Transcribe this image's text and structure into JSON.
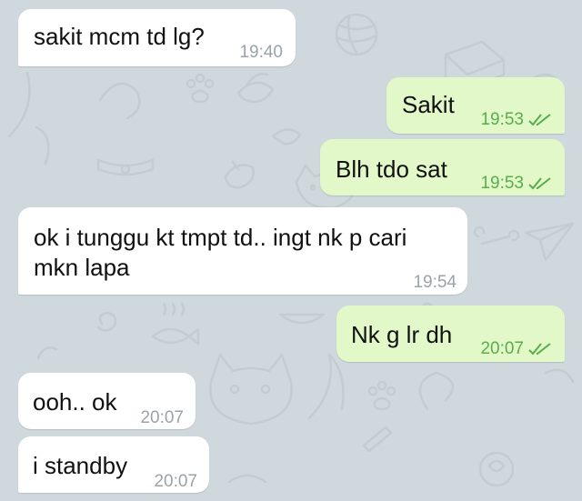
{
  "colors": {
    "background": "#cfd8dc",
    "incoming_bubble": "#ffffff",
    "outgoing_bubble": "#e2f8c8",
    "outgoing_time": "#58ad4c",
    "incoming_time": "#9aa3a8",
    "doodle": "#c3cdd1"
  },
  "messages": [
    {
      "direction": "incoming",
      "text": "sakit mcm td lg?",
      "time": "19:40"
    },
    {
      "direction": "outgoing",
      "text": "Sakit",
      "time": "19:53",
      "status": "read-double-check-icon"
    },
    {
      "direction": "outgoing",
      "text": "Blh tdo sat",
      "time": "19:53",
      "status": "read-double-check-icon"
    },
    {
      "direction": "incoming",
      "text": "ok i tunggu kt tmpt td.. ingt nk p cari\nmkn lapa",
      "time": "19:54"
    },
    {
      "direction": "outgoing",
      "text": "Nk g lr dh",
      "time": "20:07",
      "status": "read-double-check-icon"
    },
    {
      "direction": "incoming",
      "text": "ooh.. ok",
      "time": "20:07"
    },
    {
      "direction": "incoming",
      "text": "i standby",
      "time": "20:07"
    }
  ]
}
